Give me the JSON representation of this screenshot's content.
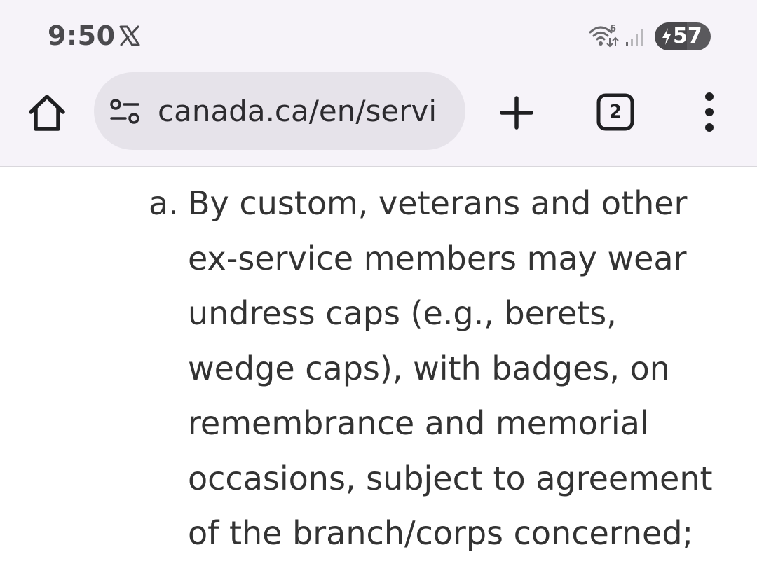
{
  "status_bar": {
    "time": "9:50",
    "notification_icons": [
      "x-logo-icon"
    ],
    "system_icons": [
      "wifi-6-icon",
      "cell-signal-icon"
    ],
    "battery_percent": "57",
    "battery_charging": true
  },
  "toolbar": {
    "home_icon": "home-icon",
    "url": "canada.ca/en/servi",
    "site_settings_icon": "tune-icon",
    "new_tab_icon": "plus-icon",
    "tab_count": "2",
    "menu_icon": "more-vert-icon"
  },
  "content": {
    "item_marker": "a.",
    "item_lines": [
      "By custom, veterans and other",
      "ex-service members may wear",
      "undress caps (e.g., berets,",
      "wedge caps), with badges, on",
      "remembrance and memorial",
      "occasions, subject to agreement",
      "of the branch/corps concerned;"
    ]
  },
  "colors": {
    "chrome_background": "#f6f3f9",
    "url_bar_background": "#e6e3ea",
    "body_text": "#333333",
    "battery_badge": "#5a595d"
  }
}
